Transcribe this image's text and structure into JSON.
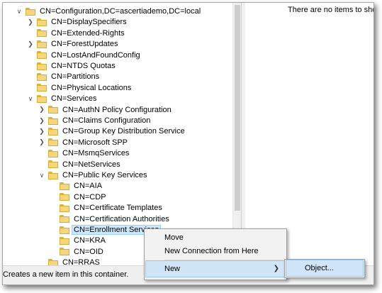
{
  "tree": [
    {
      "label": "CN=Configuration,DC=ascertiademo,DC=local",
      "expander": "expanded",
      "indent": 0
    },
    {
      "label": "CN=DisplaySpecifiers",
      "expander": "collapsed",
      "indent": 1
    },
    {
      "label": "CN=Extended-Rights",
      "expander": "none",
      "indent": 1
    },
    {
      "label": "CN=ForestUpdates",
      "expander": "collapsed",
      "indent": 1
    },
    {
      "label": "CN=LostAndFoundConfig",
      "expander": "none",
      "indent": 1
    },
    {
      "label": "CN=NTDS Quotas",
      "expander": "none",
      "indent": 1
    },
    {
      "label": "CN=Partitions",
      "expander": "none",
      "indent": 1
    },
    {
      "label": "CN=Physical Locations",
      "expander": "none",
      "indent": 1
    },
    {
      "label": "CN=Services",
      "expander": "expanded",
      "indent": 1
    },
    {
      "label": "CN=AuthN Policy Configuration",
      "expander": "collapsed",
      "indent": 2
    },
    {
      "label": "CN=Claims Configuration",
      "expander": "collapsed",
      "indent": 2
    },
    {
      "label": "CN=Group Key Distribution Service",
      "expander": "collapsed",
      "indent": 2
    },
    {
      "label": "CN=Microsoft SPP",
      "expander": "collapsed",
      "indent": 2
    },
    {
      "label": "CN=MsmqServices",
      "expander": "none",
      "indent": 2
    },
    {
      "label": "CN=NetServices",
      "expander": "none",
      "indent": 2
    },
    {
      "label": "CN=Public Key Services",
      "expander": "expanded",
      "indent": 2
    },
    {
      "label": "CN=AIA",
      "expander": "none",
      "indent": 3
    },
    {
      "label": "CN=CDP",
      "expander": "none",
      "indent": 3
    },
    {
      "label": "CN=Certificate Templates",
      "expander": "none",
      "indent": 3
    },
    {
      "label": "CN=Certification Authorities",
      "expander": "none",
      "indent": 3
    },
    {
      "label": "CN=Enrollment Services",
      "expander": "none",
      "indent": 3,
      "selected": true
    },
    {
      "label": "CN=KRA",
      "expander": "none",
      "indent": 3
    },
    {
      "label": "CN=OID",
      "expander": "none",
      "indent": 3
    },
    {
      "label": "CN=RRAS",
      "expander": "none",
      "indent": 2
    }
  ],
  "list_pane": {
    "empty_message": "There are no items to show"
  },
  "statusbar": {
    "text": "Creates a new item in this container."
  },
  "context_menu": {
    "move": "Move",
    "new_connection": "New Connection from Here",
    "new": "New"
  },
  "submenu": {
    "object": "Object..."
  },
  "icons": {
    "expanded": "chevron-down-icon",
    "collapsed": "chevron-right-icon",
    "submenu": "chevron-right-icon",
    "node": "folder-icon"
  },
  "colors": {
    "folder": "#f6d67c",
    "selection": "#cce8ff",
    "menu_highlight": "#d0e5f8",
    "menu_bg": "#f2f2f2"
  }
}
